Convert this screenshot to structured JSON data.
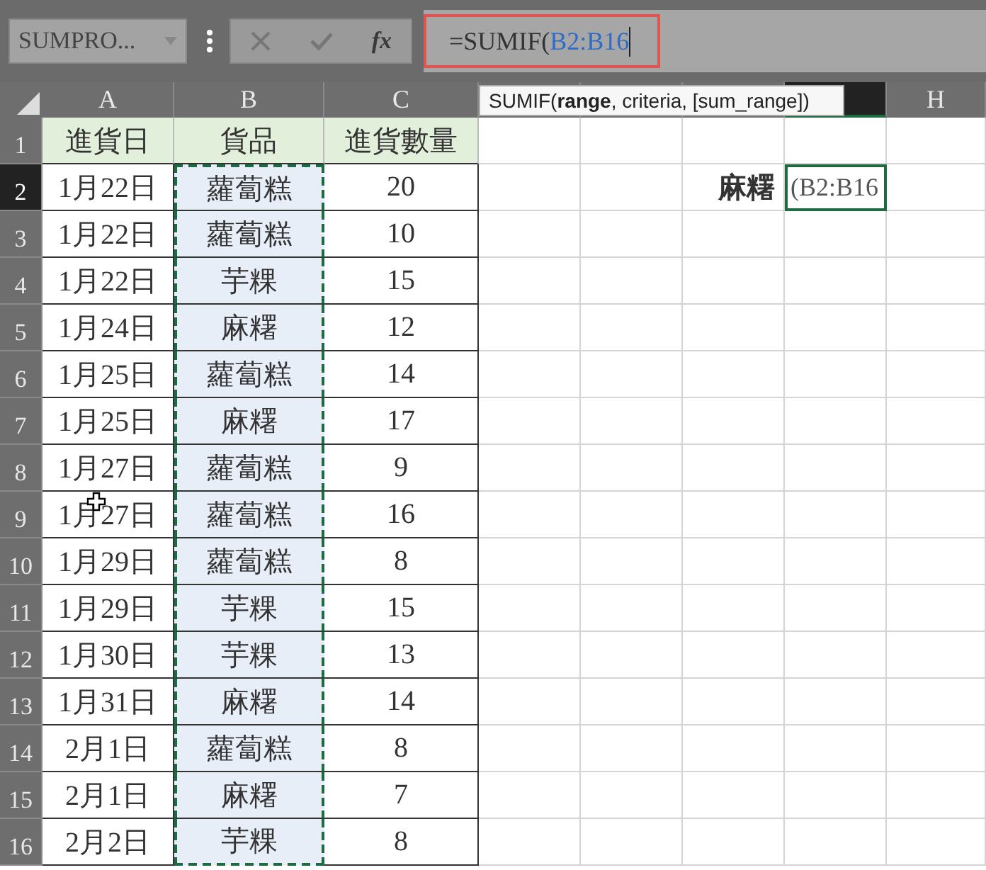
{
  "formula_bar": {
    "name_box": "SUMPRO...",
    "insert_function": "fx",
    "formula_text": "=SUMIF(",
    "formula_reference": "B2:B16",
    "tooltip": "SUMIF(**range**, criteria, [sum_range])"
  },
  "columns": [
    {
      "label": "A",
      "selected": false
    },
    {
      "label": "B",
      "selected": false
    },
    {
      "label": "C",
      "selected": false
    },
    {
      "selected": false
    },
    {
      "selected": false
    },
    {
      "selected": false
    },
    {
      "selected": true
    },
    {
      "label": "H",
      "selected": false
    }
  ],
  "rows": [
    {
      "number": "1",
      "kind": "header",
      "selected": false,
      "in_range": false,
      "date": "進貨日",
      "item": "貨品",
      "quantity": "進貨數量"
    },
    {
      "number": "2",
      "kind": "data",
      "selected": true,
      "in_range": true,
      "date": "1月22日",
      "item": "蘿蔔糕",
      "quantity": "20",
      "lookup_label": "麻糬",
      "active_cell": "(B2:B16"
    },
    {
      "number": "3",
      "kind": "data",
      "selected": false,
      "in_range": true,
      "date": "1月22日",
      "item": "蘿蔔糕",
      "quantity": "10"
    },
    {
      "number": "4",
      "kind": "data",
      "selected": false,
      "in_range": true,
      "date": "1月22日",
      "item": "芋粿",
      "quantity": "15"
    },
    {
      "number": "5",
      "kind": "data",
      "selected": false,
      "in_range": true,
      "date": "1月24日",
      "item": "麻糬",
      "quantity": "12"
    },
    {
      "number": "6",
      "kind": "data",
      "selected": false,
      "in_range": true,
      "date": "1月25日",
      "item": "蘿蔔糕",
      "quantity": "14"
    },
    {
      "number": "7",
      "kind": "data",
      "selected": false,
      "in_range": true,
      "date": "1月25日",
      "item": "麻糬",
      "quantity": "17"
    },
    {
      "number": "8",
      "kind": "data",
      "selected": false,
      "in_range": true,
      "date": "1月27日",
      "item": "蘿蔔糕",
      "quantity": "9"
    },
    {
      "number": "9",
      "kind": "data",
      "selected": false,
      "in_range": true,
      "date": "1月27日",
      "item": "蘿蔔糕",
      "quantity": "16"
    },
    {
      "number": "10",
      "kind": "data",
      "selected": false,
      "in_range": true,
      "date": "1月29日",
      "item": "蘿蔔糕",
      "quantity": "8"
    },
    {
      "number": "11",
      "kind": "data",
      "selected": false,
      "in_range": true,
      "date": "1月29日",
      "item": "芋粿",
      "quantity": "15"
    },
    {
      "number": "12",
      "kind": "data",
      "selected": false,
      "in_range": true,
      "date": "1月30日",
      "item": "芋粿",
      "quantity": "13"
    },
    {
      "number": "13",
      "kind": "data",
      "selected": false,
      "in_range": true,
      "date": "1月31日",
      "item": "麻糬",
      "quantity": "14"
    },
    {
      "number": "14",
      "kind": "data",
      "selected": false,
      "in_range": true,
      "date": "2月1日",
      "item": "蘿蔔糕",
      "quantity": "8"
    },
    {
      "number": "15",
      "kind": "data",
      "selected": false,
      "in_range": true,
      "date": "2月1日",
      "item": "麻糬",
      "quantity": "7"
    },
    {
      "number": "16",
      "kind": "data",
      "selected": false,
      "in_range": true,
      "date": "2月2日",
      "item": "芋粿",
      "quantity": "8"
    }
  ]
}
